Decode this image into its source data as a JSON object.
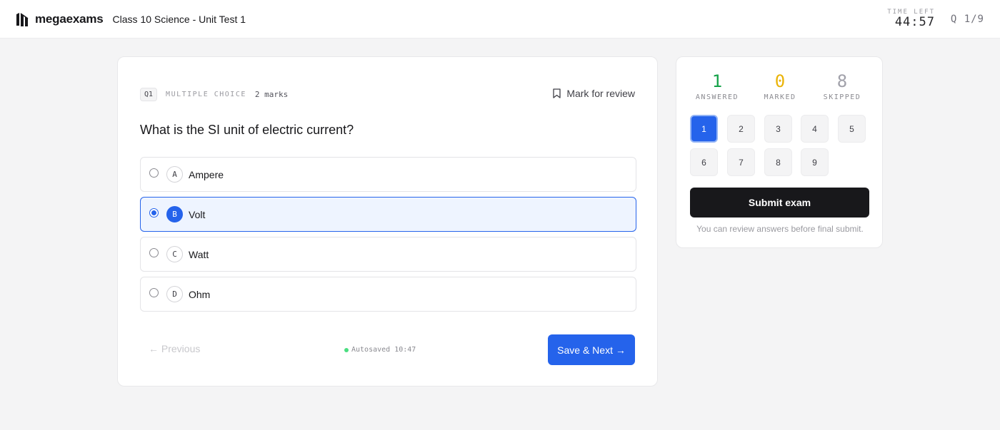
{
  "header": {
    "brand": "megaexams",
    "exam_title": "Class 10 Science - Unit Test 1",
    "timer_label": "TIME LEFT",
    "timer_value": "44:57",
    "question_counter": "Q 1/9"
  },
  "question": {
    "number_badge": "Q1",
    "type": "MULTIPLE CHOICE",
    "marks": "2 marks",
    "mark_review_label": "Mark for review",
    "text": "What is the SI unit of electric current?",
    "options": [
      {
        "letter": "A",
        "label": "Ampere",
        "selected": false
      },
      {
        "letter": "B",
        "label": "Volt",
        "selected": true
      },
      {
        "letter": "C",
        "label": "Watt",
        "selected": false
      },
      {
        "letter": "D",
        "label": "Ohm",
        "selected": false
      }
    ],
    "previous_label": "← Previous",
    "autosave_text": "Autosaved 10:47",
    "next_label": "Save & Next →"
  },
  "summary": {
    "answered": {
      "value": "1",
      "label": "ANSWERED",
      "color": "#16a34a"
    },
    "marked": {
      "value": "0",
      "label": "MARKED",
      "color": "#eab308"
    },
    "skipped": {
      "value": "8",
      "label": "SKIPPED",
      "color": "#9ca3af"
    },
    "questions": [
      "1",
      "2",
      "3",
      "4",
      "5",
      "6",
      "7",
      "8",
      "9"
    ],
    "current_question": "1",
    "submit_label": "Submit exam",
    "submit_note": "You can review answers before final submit."
  },
  "colors": {
    "accent": "#2563eb",
    "dark": "#18181b",
    "autosave_dot": "#4ade80"
  }
}
